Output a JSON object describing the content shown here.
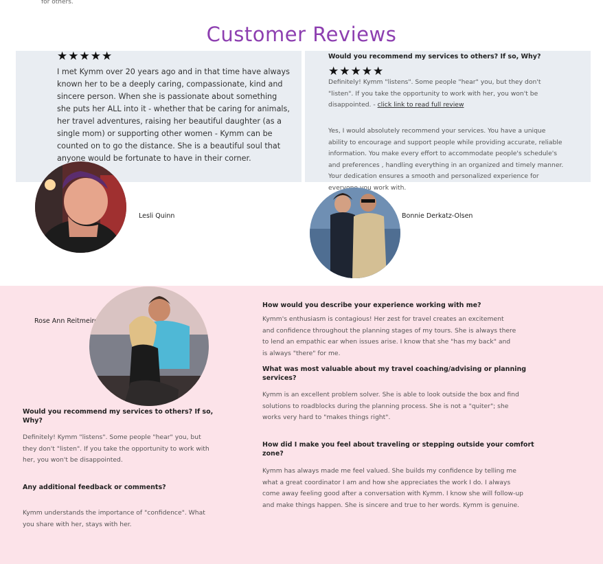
{
  "top_snippet": "for others.",
  "title": "Customer Reviews",
  "review1": {
    "stars": "★★★★★",
    "text": "I met Kymm over 20 years ago and in that time have always known her to be a deeply caring, compassionate, kind and sincere person. When she is passionate about something she puts her ALL into it - whether that be caring for animals, her travel adventures, raising her beautiful daughter (as a single mom) or supporting other women - Kymm can be counted on to go the distance. She is a beautiful soul that anyone would be fortunate to have in their corner.",
    "name": "Lesli Quinn"
  },
  "review2": {
    "question": "Would you recommend my services to others? If so, Why?",
    "stars": "★★★★★",
    "text": "Definitely! Kymm \"listens\". Some people \"hear\" you, but they don't \"listen\". If you take the opportunity to work with her, you won't be disappointed. - ",
    "link": "click link to read full review",
    "text2": "Yes, I would absolutely recommend your services. You have a unique ability to encourage and support people while providing accurate, reliable information. You make every effort to accommodate people's schedule's and preferences , handling everything in an organized and timely manner. Your dedication ensures a smooth and personalized experience for everyone you work with.",
    "name": "Bonnie Derkatz-Olsen"
  },
  "review3": {
    "name": "Rose Ann Reitmeirer",
    "q1": "Would you recommend my services to others? If so, Why?",
    "a1": "Definitely! Kymm \"listens\". Some people \"hear\" you, but they don't \"listen\". If you take the opportunity to work with her, you won't be disappointed.",
    "q2": "Any additional feedback or comments?",
    "a2": "Kymm understands the importance of \"confidence\". What you share with her, stays with her.",
    "q3": "How would you describe your experience working with me?",
    "a3": "Kymm's enthusiasm is contagious! Her zest for travel creates an excitement and confidence throughout the planning stages of my tours. She is always there to lend an empathic ear when issues arise. I know that she \"has my back\" and is always \"there\" for me.",
    "q4": "What was most valuable about my travel coaching/advising or planning services?",
    "a4": "Kymm is an excellent problem solver. She is able to look outside the box and find solutions to roadblocks during the planning process. She is not a \"quiter\"; she works very hard to \"makes things right\".",
    "q5": "How did I make you feel about traveling or stepping outside your comfort zone?",
    "a5": "Kymm has always made me feel valued. She builds my confidence by telling me what a great coordinator I am and how she appreciates the work I do. I always come away feeling good after a conversation with Kymm. I know she will follow-up and make things happen. She is sincere and true to her words. Kymm is genuine."
  }
}
